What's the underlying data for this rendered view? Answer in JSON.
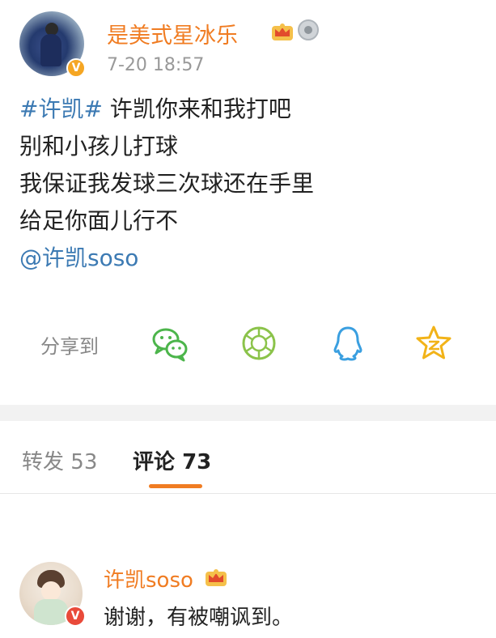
{
  "post": {
    "username": "是美式星冰乐",
    "time": "7-20 18:57",
    "verify_mark": "V",
    "body": {
      "hashtag": "#许凯#",
      "line1_text": " 许凯你来和我打吧",
      "line2": "别和小孩儿打球",
      "line3": "我保证我发球三次球还在手里",
      "line4": "给足你面儿行不",
      "mention": "@许凯soso"
    },
    "badges": [
      "crown-icon",
      "medal-icon"
    ]
  },
  "share": {
    "label": "分享到",
    "targets": [
      "wechat-icon",
      "moments-icon",
      "qq-icon",
      "qzone-icon"
    ]
  },
  "tabs": {
    "repost_label": "转发",
    "repost_count": "53",
    "comment_label": "评论",
    "comment_count": "73"
  },
  "comment": {
    "username": "许凯soso",
    "verify_mark": "V",
    "text": "谢谢，有被嘲讽到。",
    "badges": [
      "crown-icon"
    ]
  },
  "colors": {
    "accent": "#f07c22",
    "link": "#3c7ab3",
    "muted": "#888888",
    "wechat": "#4cb54b",
    "qq": "#3a9fe0",
    "qzone": "#f2b318"
  }
}
